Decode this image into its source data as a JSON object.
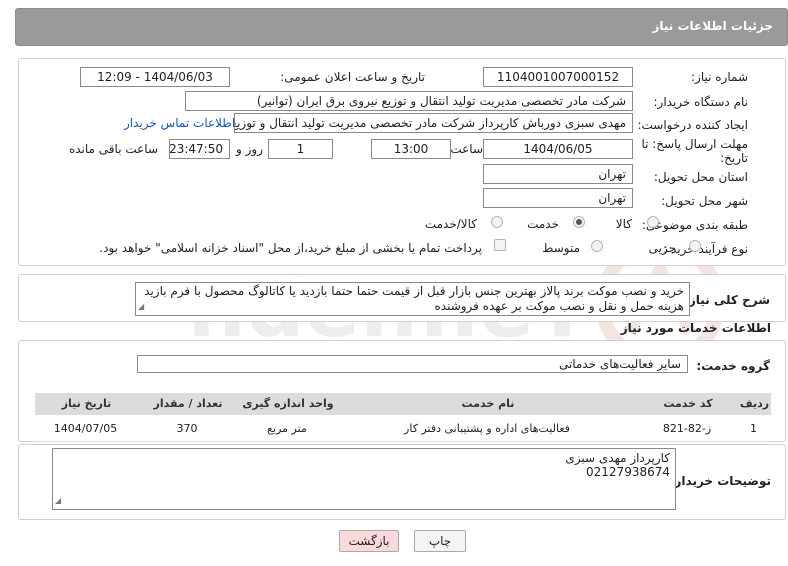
{
  "page_title": "جزئیات اطلاعات نیاز",
  "fields": {
    "need_number_label": "شماره نیاز:",
    "need_number": "1104001007000152",
    "announce_label": "تاریخ و ساعت اعلان عمومی:",
    "announce_value": "1404/06/03 - 12:09",
    "buyer_org_label": "نام دستگاه خریدار:",
    "buyer_org": "شرکت مادر تخصصی مدیریت تولید  انتقال و توزیع نیروی برق ایران (توانیر)",
    "requester_label": "ایجاد کننده درخواست:",
    "requester": "مهدی سبزی دورباش کارپرداز شرکت مادر تخصصی مدیریت تولید  انتقال و توزیع نیروی برق ایران",
    "contact_link": "اطلاعات تماس خریدار",
    "deadline_label_1": "مهلت ارسال پاسخ: تا",
    "deadline_label_2": "تاریخ:",
    "deadline_date": "1404/06/05",
    "time_label": "ساعت",
    "deadline_time": "13:00",
    "days_value": "1",
    "days_label": "روز و",
    "remaining_time": "23:47:50",
    "remaining_label": "ساعت باقی مانده",
    "province_label": "استان محل تحویل:",
    "province": "تهران",
    "city_label": "شهر محل تحویل:",
    "city": "تهران",
    "category_label": "طبقه بندی موضوعی:",
    "category_options": [
      "کالا",
      "خدمت",
      "کالا/خدمت"
    ],
    "process_label": "نوع فرآیند خرید :",
    "process_options": [
      "جزیی",
      "متوسط"
    ],
    "payment_note": "پرداخت تمام یا بخشی از مبلغ خرید،از محل \"اسناد خزانه اسلامی\" خواهد بود."
  },
  "description": {
    "label": "شرح کلی نیاز:",
    "text": "خرید و نصب موکت برند پالاز بهترین جنس بازار قبل از قیمت حتما حتما بازدید یا کاتالوگ محصول با فرم بازید هزینه حمل و نقل و نصب موکت بر عهده فروشنده"
  },
  "services": {
    "section_title": "اطلاعات خدمات مورد نیاز",
    "group_label": "گروه خدمت:",
    "group_value": "سایر فعالیت‌های خدماتی",
    "columns": [
      "ردیف",
      "کد خدمت",
      "نام خدمت",
      "واحد اندازه گیری",
      "تعداد / مقدار",
      "تاریخ نیاز"
    ],
    "rows": [
      [
        "1",
        "ز-82-821",
        "فعالیت‌های اداره و پشتیبانی دفتر کار",
        "متر مربع",
        "370",
        "1404/07/05"
      ]
    ]
  },
  "buyer_notes": {
    "label": "توضیحات خریدار:",
    "line1": "کارپرداز مهدی سبزی",
    "line2": "02127938674"
  },
  "buttons": {
    "print": "چاپ",
    "back": "بازگشت"
  },
  "watermark": "AriaTender.neT",
  "colors": {
    "title_bar": "#9a9a9a",
    "link": "#1a56b0",
    "table_header": "#dcdcdc",
    "back_button": "#f9d9d9"
  }
}
